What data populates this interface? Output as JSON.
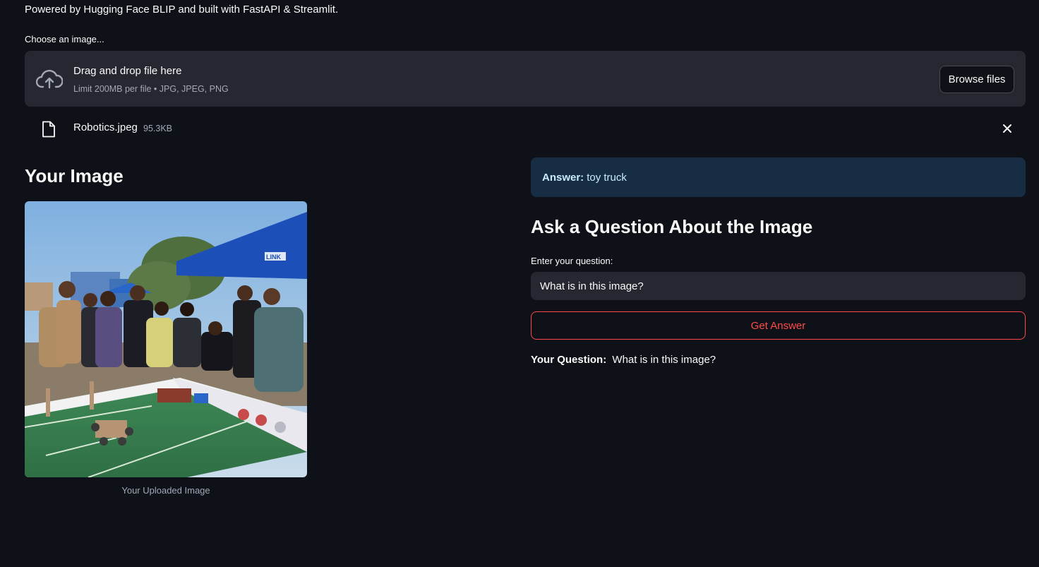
{
  "header": {
    "subtitle": "Powered by Hugging Face BLIP and built with FastAPI & Streamlit."
  },
  "uploader": {
    "label": "Choose an image...",
    "drop_text": "Drag and drop file here",
    "limit_text": "Limit 200MB per file • JPG, JPEG, PNG",
    "browse_label": "Browse files",
    "icon": "cloud-upload-icon"
  },
  "uploaded_file": {
    "name": "Robotics.jpeg",
    "size": "95.3KB",
    "icon": "file-icon",
    "remove_icon": "close-icon"
  },
  "left": {
    "heading": "Your Image",
    "image_caption": "Your Uploaded Image",
    "image_text": "LINK"
  },
  "right": {
    "answer_label": "Answer:",
    "answer_value": "toy truck",
    "heading": "Ask a Question About the Image",
    "question_label": "Enter your question:",
    "question_value": "What is in this image?",
    "button_label": "Get Answer",
    "your_question_label": "Your Question:",
    "your_question_value": "What is in this image?"
  },
  "colors": {
    "background": "#0e1117",
    "surface": "#262730",
    "accent": "#ff4b4b",
    "info_bg": "#172d43",
    "info_text": "#c7ebff"
  }
}
